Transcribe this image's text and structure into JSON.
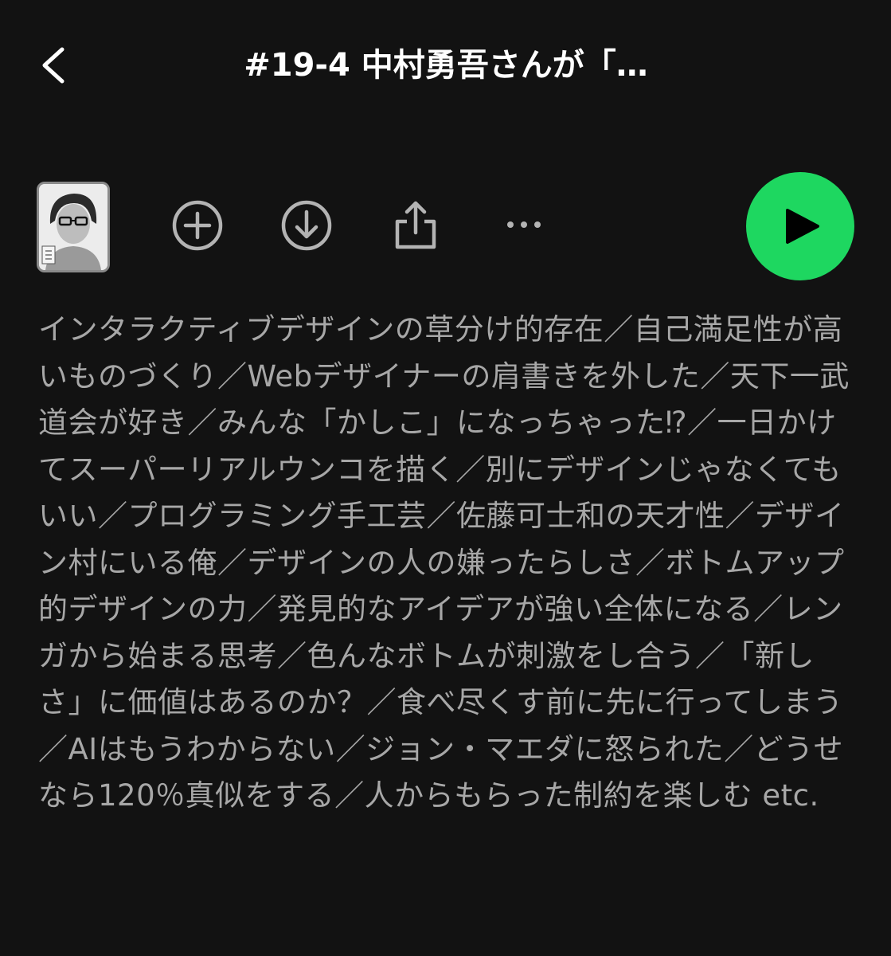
{
  "header": {
    "back_icon": "chevron-left-icon",
    "title": "#19-4 中村勇吾さんが「…"
  },
  "toolbar": {
    "thumbnail_icon": "podcast-cover-thumbnail",
    "add_icon": "plus-circle-icon",
    "download_icon": "download-circle-icon",
    "share_icon": "share-icon",
    "more_icon": "more-horizontal-icon",
    "play_icon": "play-icon",
    "play_color": "#1ed760"
  },
  "description": {
    "text": "インタラクティブデザインの草分け的存在／自己満足性が高いものづくり／Webデザイナーの肩書きを外した／天下一武道会が好き／みんな「かしこ」になっちゃった⁉／一日かけてスーパーリアルウンコを描く／別にデザインじゃなくてもいい／プログラミング手工芸／佐藤可士和の天才性／デザイン村にいる俺／デザインの人の嫌ったらしさ／ボトムアップ的デザインの力／発見的なアイデアが強い全体になる／レンガから始まる思考／色んなボトムが刺激をし合う／「新しさ」に価値はあるのか？／食べ尽くす前に先に行ってしまう／AIはもうわからない／ジョン・マエダに怒られた／どうせなら120％真似をする／人からもらった制約を楽しむ etc."
  },
  "colors": {
    "background": "#121212",
    "text_primary": "#ffffff",
    "text_secondary": "#a7a7a7",
    "accent": "#1ed760"
  }
}
